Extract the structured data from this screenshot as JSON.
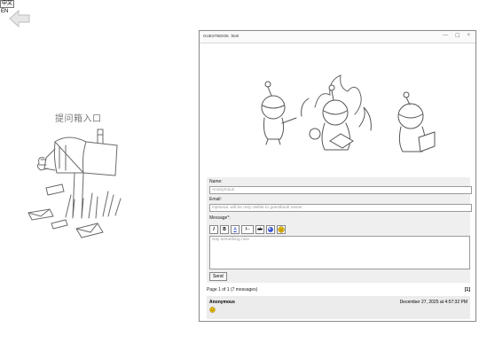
{
  "lang": {
    "zh": "中文",
    "en": "EN"
  },
  "left_panel": {
    "label": "提问箱入口"
  },
  "window": {
    "title": "GUESTBOOK .html",
    "controls": {
      "minimize": "—",
      "maximize": "☐",
      "close": "×"
    }
  },
  "form": {
    "name_label": "Name:",
    "name_placeholder": "Anonymous",
    "email_label": "Email:",
    "email_placeholder": "Optional, will be only visible to guestbook owner",
    "message_label": "Message*:",
    "message_placeholder": "Say something nice",
    "toolbar": {
      "italic": "I",
      "bold": "B",
      "underline": "A",
      "code": "f─",
      "strike": "ab"
    },
    "send_label": "Send"
  },
  "pager": {
    "text": "Page 1 of 1 (7 messages)",
    "page": "[1]"
  },
  "entries": [
    {
      "name": "Anonymous",
      "date": "December 27, 2025 at 4:57:32 PM"
    }
  ],
  "colors": {
    "smiley": "#f2c200",
    "window_border": "#8c8c8c",
    "form_bg": "#efefef"
  }
}
